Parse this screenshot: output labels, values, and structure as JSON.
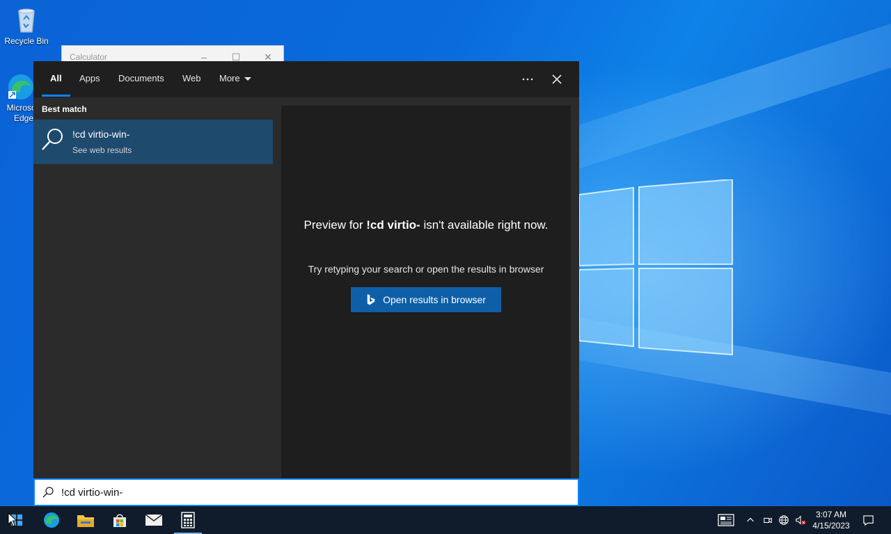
{
  "desktop": {
    "icons": [
      {
        "label": "Recycle Bin"
      },
      {
        "label": "Microsoft Edge"
      }
    ]
  },
  "calculator_window": {
    "title": "Calculator"
  },
  "search_panel": {
    "tabs": [
      {
        "label": "All"
      },
      {
        "label": "Apps"
      },
      {
        "label": "Documents"
      },
      {
        "label": "Web"
      },
      {
        "label": "More"
      }
    ],
    "best_match_label": "Best match",
    "best_match": {
      "title": "!cd virtio-win-",
      "subtitle": "See web results"
    },
    "preview": {
      "msg_before": "Preview for ",
      "msg_query": "!cd virtio-",
      "msg_after": " isn't available right now.",
      "hint": "Try retyping your search or open the results in browser",
      "button_label": "Open results in browser"
    }
  },
  "search_box": {
    "value": "!cd virtio-win-"
  },
  "taskbar": {
    "clock_time": "3:07 AM",
    "clock_date": "4/15/2023"
  },
  "colors": {
    "accent": "#0a84ff",
    "selected_item": "#1e4a6e",
    "button": "#0f5fa8",
    "taskbar": "#101c2b"
  }
}
